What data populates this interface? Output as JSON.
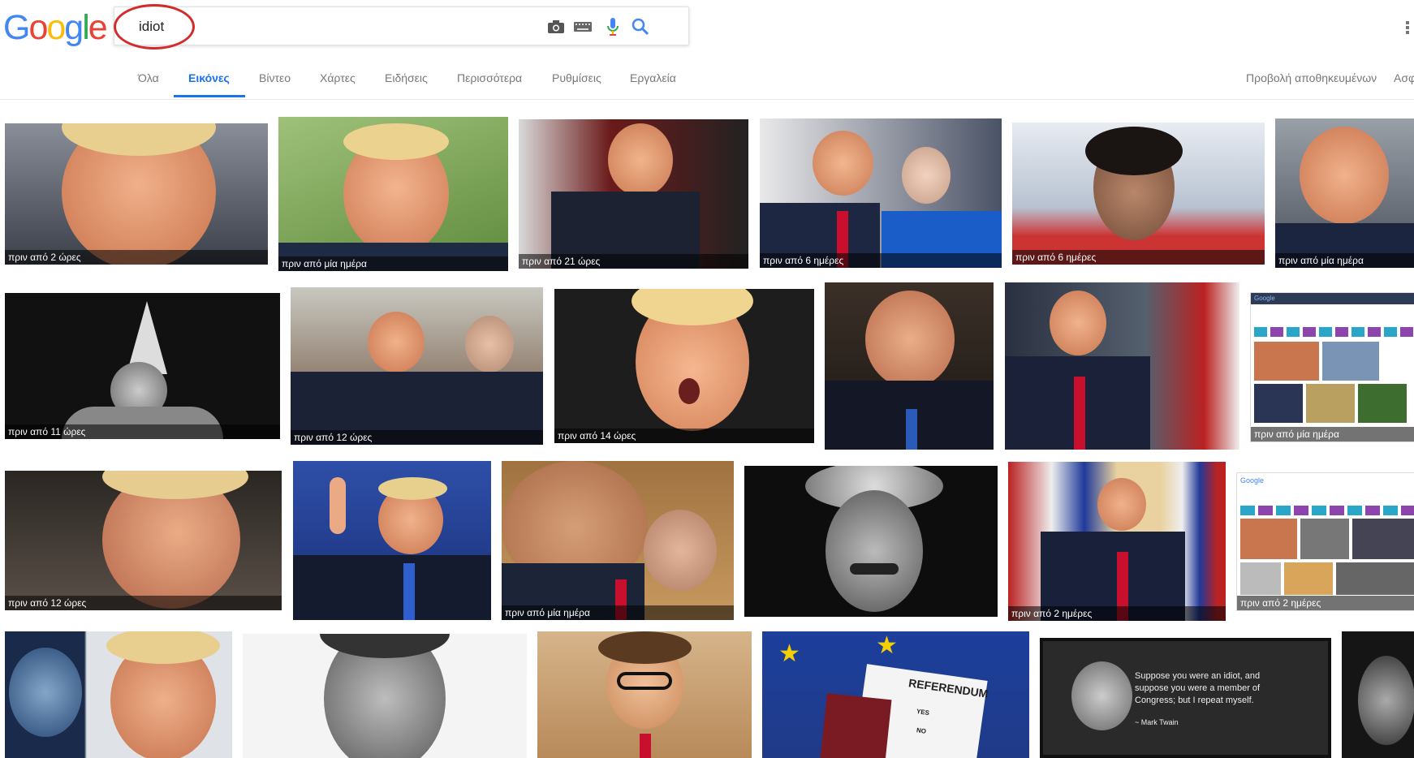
{
  "logo": {
    "letters": [
      {
        "ch": "G",
        "color": "#4285f4"
      },
      {
        "ch": "o",
        "color": "#ea4335"
      },
      {
        "ch": "o",
        "color": "#fbbc05"
      },
      {
        "ch": "g",
        "color": "#4285f4"
      },
      {
        "ch": "l",
        "color": "#34a853"
      },
      {
        "ch": "e",
        "color": "#ea4335"
      }
    ]
  },
  "search": {
    "query": "idiot",
    "icons": [
      "camera-icon",
      "keyboard-icon",
      "microphone-icon",
      "search-icon"
    ]
  },
  "tabs": [
    "Όλα",
    "Εικόνες",
    "Βίντεο",
    "Χάρτες",
    "Ειδήσεις",
    "Περισσότερα",
    "Ρυθμίσεις",
    "Εργαλεία"
  ],
  "active_tab": "Εικόνες",
  "header_right": {
    "saved": "Προβολή αποθηκευμένων",
    "safe": "Ασφ"
  },
  "colors": {
    "accent": "#1a73e8",
    "highlight_circle": "#d42a2a"
  },
  "results": {
    "captions": [
      "πριν από 2 ώρες",
      "πριν από μία ημέρα",
      "πριν από 21 ώρες",
      "πριν από 6 ημέρες",
      "πριν από 6 ημέρες",
      "πριν από μία ημέρα",
      "πριν από 11 ώρες",
      "πριν από 12 ώρες",
      "πριν από 14 ώρες",
      "",
      "",
      "πριν από μία ημέρα",
      "πριν από 12 ώρες",
      "",
      "πριν από μία ημέρα",
      "",
      "πριν από 2 ημέρες",
      "πριν από 2 ημέρες"
    ],
    "referendum": {
      "title": "REFERENDUM",
      "yes": "YES",
      "no": "NO"
    },
    "quote": {
      "text": "Suppose you were an idiot, and suppose you were a member of Congress; but I repeat myself.",
      "author": "~ Mark Twain"
    },
    "thumb_logo": "Google"
  }
}
